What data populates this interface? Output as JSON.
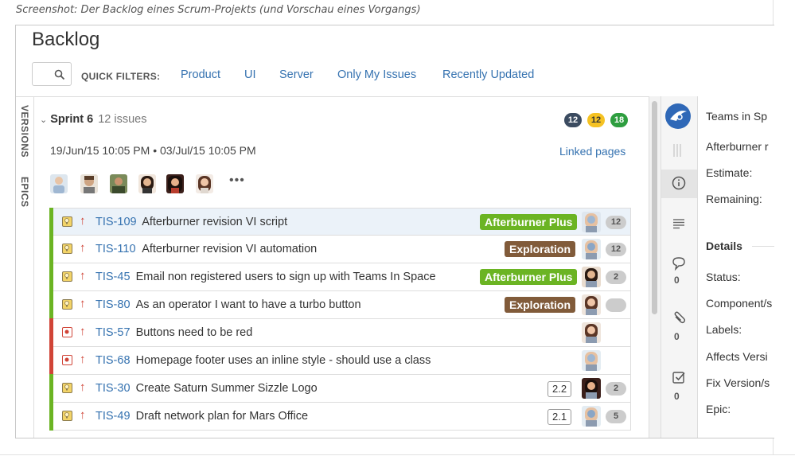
{
  "caption": "Screenshot: Der Backlog eines Scrum-Projekts (und Vorschau eines Vorgangs)",
  "page_title": "Backlog",
  "quick_filters": {
    "label": "QUICK FILTERS:",
    "items": [
      "Product",
      "UI",
      "Server",
      "Only My Issues",
      "Recently Updated"
    ]
  },
  "side_tabs": {
    "versions": "VERSIONS",
    "epics": "EPICS"
  },
  "sprint": {
    "name": "Sprint 6",
    "issue_count": "12 issues",
    "status_counts": [
      {
        "value": "12",
        "color": "#3b4b60"
      },
      {
        "value": "12",
        "color": "#f5c223"
      },
      {
        "value": "18",
        "color": "#2e9e3f"
      }
    ],
    "dates": "19/Jun/15 10:05 PM • 03/Jul/15 10:05 PM",
    "linked_pages": "Linked pages",
    "more": "•••"
  },
  "issues": [
    {
      "key": "TIS-109",
      "summary": "Afterburner revision VI script",
      "type": "story",
      "epic": "Afterburner Plus",
      "epic_color": "#6bb423",
      "estimate": "",
      "badge": "12",
      "selected": true
    },
    {
      "key": "TIS-110",
      "summary": "Afterburner revision VI automation",
      "type": "story",
      "epic": "Exploration",
      "epic_color": "#815b3a",
      "estimate": "",
      "badge": "12",
      "selected": false
    },
    {
      "key": "TIS-45",
      "summary": "Email non registered users to sign up with Teams In Space",
      "type": "story",
      "epic": "Afterburner Plus",
      "epic_color": "#6bb423",
      "estimate": "",
      "badge": "2",
      "selected": false
    },
    {
      "key": "TIS-80",
      "summary": "As an operator I want to have a turbo button",
      "type": "story",
      "epic": "Exploration",
      "epic_color": "#815b3a",
      "estimate": "",
      "badge": "",
      "selected": false
    },
    {
      "key": "TIS-57",
      "summary": "Buttons need to be red",
      "type": "bug",
      "epic": "",
      "epic_color": "",
      "estimate": "",
      "badge": null,
      "selected": false
    },
    {
      "key": "TIS-68",
      "summary": "Homepage footer uses an inline style - should use a class",
      "type": "bug",
      "epic": "",
      "epic_color": "",
      "estimate": "",
      "badge": null,
      "selected": false
    },
    {
      "key": "TIS-30",
      "summary": "Create Saturn Summer Sizzle Logo",
      "type": "story",
      "epic": "",
      "epic_color": "",
      "estimate": "2.2",
      "badge": "2",
      "selected": false
    },
    {
      "key": "TIS-49",
      "summary": "Draft network plan for Mars Office",
      "type": "story",
      "epic": "",
      "epic_color": "",
      "estimate": "2.1",
      "badge": "5",
      "selected": false
    }
  ],
  "right_sidebar": {
    "comments_count": "0",
    "attachments_count": "0",
    "subtasks_count": "0"
  },
  "detail_panel": {
    "project": "Teams in Sp",
    "issue_title": "Afterburner r",
    "estimate_label": "Estimate:",
    "remaining_label": "Remaining:",
    "section_title": "Details",
    "fields": [
      "Status:",
      "Component/s",
      "Labels:",
      "Affects Versi",
      "Fix Version/s",
      "Epic:"
    ]
  },
  "colors": {
    "link": "#3572b0",
    "priority_arrow": "#d04437",
    "story_bar": "#6bb423",
    "bug_bar": "#d04437"
  }
}
